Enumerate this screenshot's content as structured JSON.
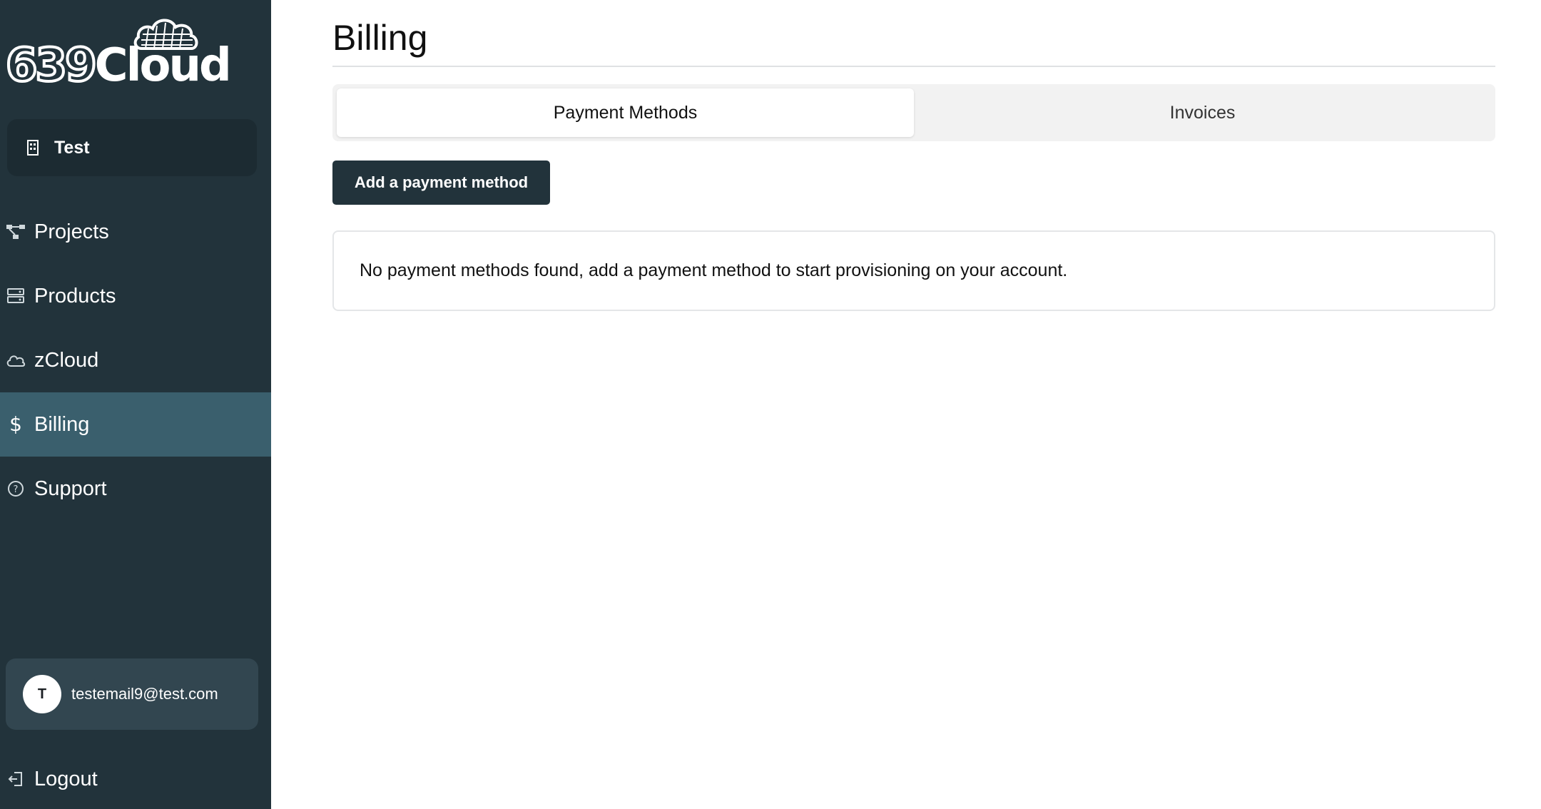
{
  "brand": {
    "name": "639Cloud",
    "digits": "639",
    "word": "Cloud"
  },
  "org": {
    "name": "Test",
    "icon": "building-icon"
  },
  "nav": {
    "items": [
      {
        "label": "Projects",
        "icon": "project-diagram-icon"
      },
      {
        "label": "Products",
        "icon": "server-icon"
      },
      {
        "label": "zCloud",
        "icon": "cloud-icon"
      },
      {
        "label": "Billing",
        "icon": "dollar-icon",
        "active": true
      },
      {
        "label": "Support",
        "icon": "question-circle-icon"
      }
    ]
  },
  "user": {
    "initial": "T",
    "email": "testemail9@test.com"
  },
  "logout": {
    "label": "Logout",
    "icon": "logout-icon"
  },
  "page": {
    "title": "Billing"
  },
  "tabs": [
    {
      "label": "Payment Methods",
      "active": true
    },
    {
      "label": "Invoices",
      "active": false
    }
  ],
  "actions": {
    "add_payment_label": "Add a payment method"
  },
  "empty_state": {
    "message": "No payment methods found, add a payment method to start provisioning on your account."
  },
  "colors": {
    "sidebar_bg": "#22333b",
    "active_nav_bg": "#3a5f6d",
    "primary_button": "#22333b",
    "tab_bar_bg": "#f2f2f2"
  }
}
